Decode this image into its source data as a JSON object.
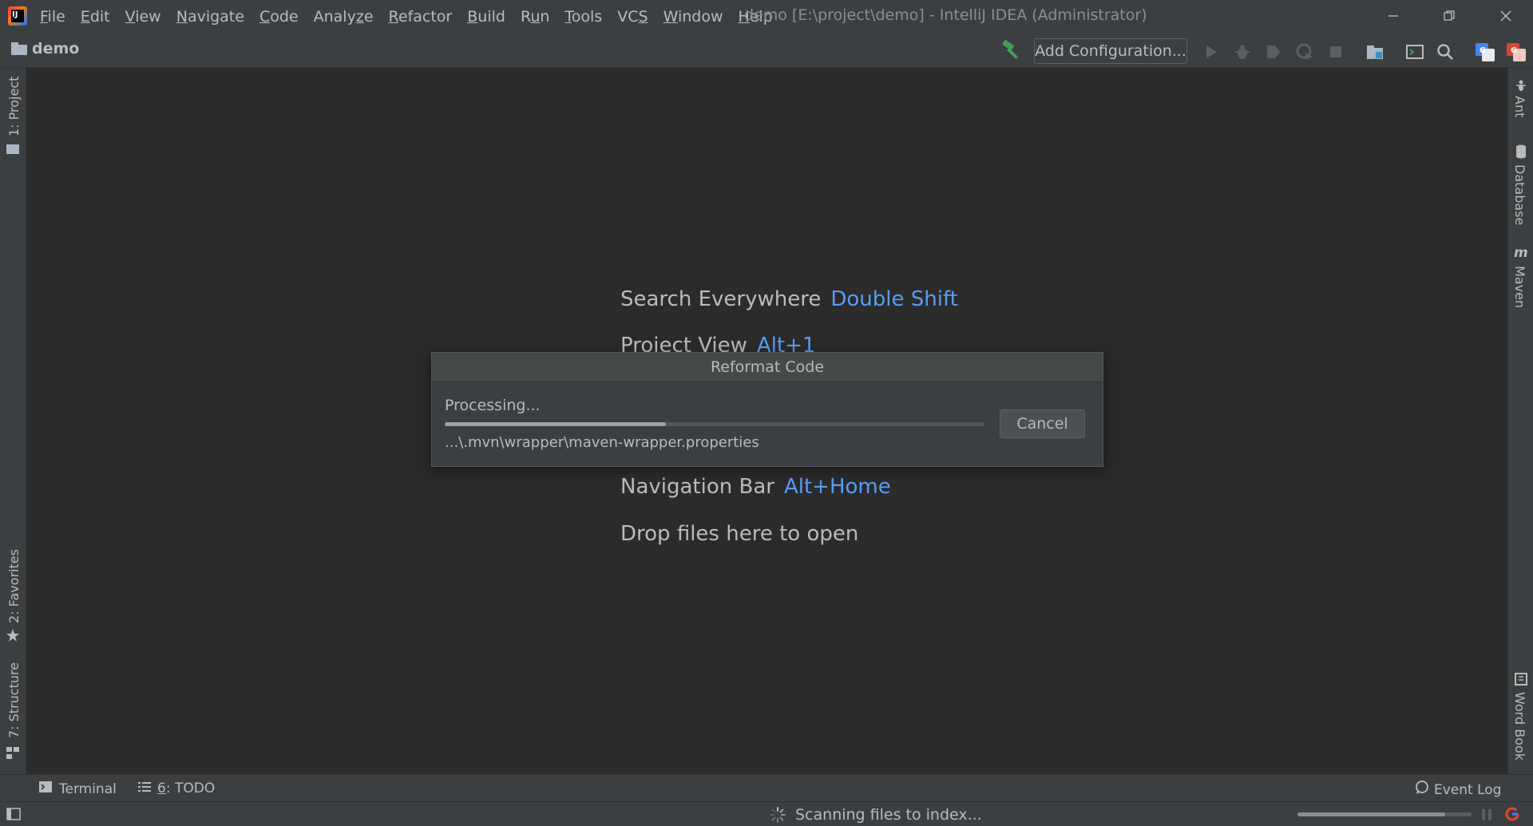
{
  "titlebar": {
    "menu": [
      {
        "pre": "",
        "mnemonic": "F",
        "post": "ile"
      },
      {
        "pre": "",
        "mnemonic": "E",
        "post": "dit"
      },
      {
        "pre": "",
        "mnemonic": "V",
        "post": "iew"
      },
      {
        "pre": "",
        "mnemonic": "N",
        "post": "avigate"
      },
      {
        "pre": "",
        "mnemonic": "C",
        "post": "ode"
      },
      {
        "pre": "Analy",
        "mnemonic": "z",
        "post": "e"
      },
      {
        "pre": "",
        "mnemonic": "R",
        "post": "efactor"
      },
      {
        "pre": "",
        "mnemonic": "B",
        "post": "uild"
      },
      {
        "pre": "R",
        "mnemonic": "u",
        "post": "n"
      },
      {
        "pre": "",
        "mnemonic": "T",
        "post": "ools"
      },
      {
        "pre": "VC",
        "mnemonic": "S",
        "post": ""
      },
      {
        "pre": "",
        "mnemonic": "W",
        "post": "indow"
      },
      {
        "pre": "",
        "mnemonic": "H",
        "post": "elp"
      }
    ],
    "window_title": "demo [E:\\project\\demo] - IntelliJ IDEA (Administrator)"
  },
  "navbar": {
    "project_name": "demo",
    "add_configuration": "Add Configuration..."
  },
  "left_tabs": {
    "project": "1: Project",
    "favorites": "2: Favorites",
    "structure": "7: Structure"
  },
  "right_tabs": {
    "ant": "Ant",
    "database": "Database",
    "maven": "Maven",
    "word_book": "Word Book"
  },
  "editor_hints": {
    "search_label": "Search Everywhere",
    "search_key": "Double Shift",
    "project_label": "Project View",
    "project_key": "Alt+1",
    "navbar_label": "Navigation Bar",
    "navbar_key": "Alt+Home",
    "drop_label": "Drop files here to open"
  },
  "dialog": {
    "title": "Reformat Code",
    "status": "Processing...",
    "progress_fraction": 0.41,
    "file": "...\\.mvn\\wrapper\\maven-wrapper.properties",
    "cancel_label": "Cancel"
  },
  "bottom_bar": {
    "terminal": "Terminal",
    "todo_mnemonic": "6",
    "todo_rest": ": TODO",
    "event_log": "Event Log"
  },
  "status_bar": {
    "text": "Scanning files to index...",
    "progress_fraction": 0.85
  },
  "colors": {
    "background": "#2b2b2b",
    "chrome": "#3c3f41",
    "link_key": "#589df6",
    "run_hammer": "#499c54"
  }
}
